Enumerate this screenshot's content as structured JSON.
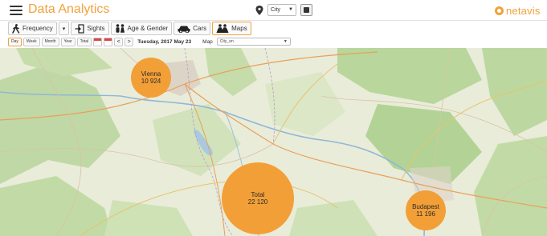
{
  "header": {
    "app_title": "Data Analytics",
    "city_select": "City",
    "brand": "netavis"
  },
  "tabs": [
    {
      "label": "Frequency",
      "icon": "walker-icon"
    },
    {
      "label": "▾",
      "icon": ""
    },
    {
      "label": "Sights",
      "icon": "enter-icon"
    },
    {
      "label": "Age & Gender",
      "icon": "people-icon"
    },
    {
      "label": "Cars",
      "icon": "car-icon"
    },
    {
      "label": "Maps",
      "icon": "map-people-icon",
      "active": true
    }
  ],
  "period_buttons": [
    "Day",
    "Week",
    "Month",
    "Year",
    "Total"
  ],
  "nav": {
    "prev": "<",
    "next": ">"
  },
  "date_label": "Tuesday, 2017 May 23",
  "map_label": "Map",
  "map_select": "City_en",
  "colors": {
    "accent": "#f0a23a",
    "bubble": "#f39f37",
    "map_bg": "#e9ecd9",
    "forest": "#b8d59b"
  },
  "bubbles": [
    {
      "name": "Vienna",
      "value": "10 924"
    },
    {
      "name": "Total",
      "value": "22 120"
    },
    {
      "name": "Budapest",
      "value": "11 196"
    }
  ]
}
